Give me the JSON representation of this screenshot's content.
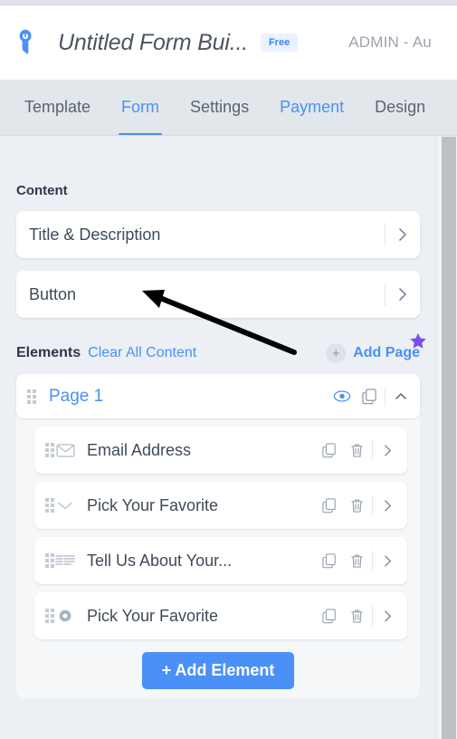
{
  "header": {
    "logo_icon": "jotform-logo-icon",
    "form_title": "Untitled Form Bui...",
    "plan_badge": "Free",
    "account_text": "ADMIN - Au"
  },
  "tabs": [
    {
      "label": "Template",
      "state": "default"
    },
    {
      "label": "Form",
      "state": "active"
    },
    {
      "label": "Settings",
      "state": "default"
    },
    {
      "label": "Payment",
      "state": "link"
    },
    {
      "label": "Design",
      "state": "default"
    }
  ],
  "content": {
    "section_label": "Content",
    "cards": [
      {
        "label": "Title & Description",
        "chevron": "chevron-right-icon"
      },
      {
        "label": "Button",
        "chevron": "chevron-right-icon"
      }
    ]
  },
  "elements": {
    "title": "Elements",
    "clear_all_label": "Clear All Content",
    "add_page_label": "Add Page",
    "add_page_plus": "+",
    "star_icon": "star-icon",
    "page": {
      "name": "Page 1",
      "drag_handle": "drag-handle-icon",
      "preview_icon": "eye-icon",
      "duplicate_icon": "copy-icon",
      "collapse_icon": "chevron-up-icon"
    },
    "items": [
      {
        "label": "Email Address",
        "type_icon": "envelope-icon"
      },
      {
        "label": "Pick Your Favorite",
        "type_icon": "chevron-down-icon"
      },
      {
        "label": "Tell Us About Your...",
        "type_icon": "paragraph-lines-icon"
      },
      {
        "label": "Pick Your Favorite",
        "type_icon": "radio-button-icon"
      }
    ],
    "row_actions": {
      "duplicate_icon": "copy-icon",
      "delete_icon": "trash-icon",
      "expand_icon": "chevron-right-icon"
    },
    "add_element_label": "+ Add Element"
  },
  "annotation": {
    "arrow_icon": "pointer-arrow-annotation"
  },
  "colors": {
    "accent": "#4a90f7",
    "badge_bg": "#eaf2ff",
    "page_bg": "#eceff3",
    "star": "#7c4dee"
  }
}
